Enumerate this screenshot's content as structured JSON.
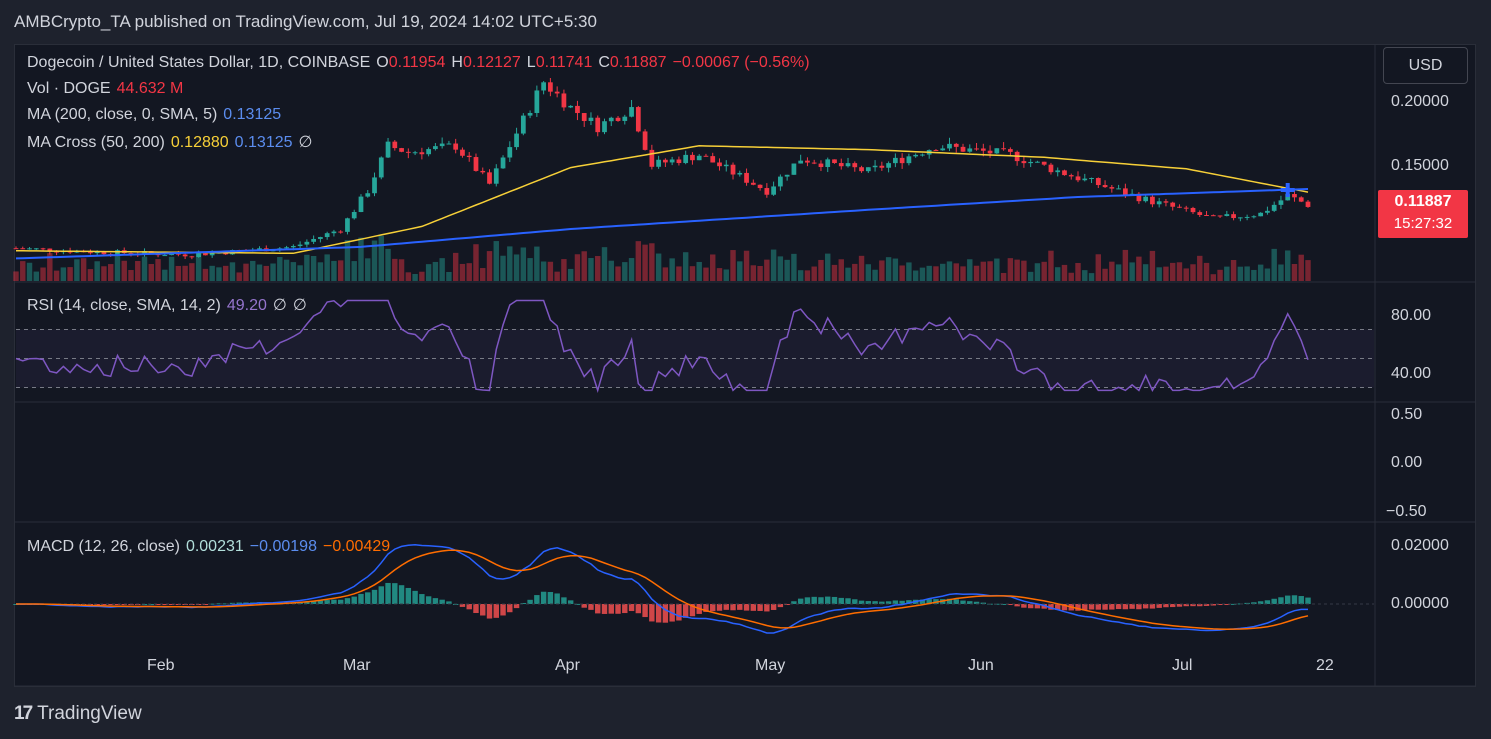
{
  "header": {
    "publisher_line": "AMBCrypto_TA published on TradingView.com, Jul 19, 2024 14:02 UTC+5:30"
  },
  "legend": {
    "symbol": "Dogecoin / United States Dollar, 1D, COINBASE",
    "o_label": "O",
    "o_value": "0.11954",
    "h_label": "H",
    "h_value": "0.12127",
    "l_label": "L",
    "l_value": "0.11741",
    "c_label": "C",
    "c_value": "0.11887",
    "change": "−0.00067 (−0.56%)",
    "vol_label": "Vol · DOGE",
    "vol_value": "44.632 M",
    "ma_label": "MA (200, close, 0, SMA, 5)",
    "ma_value": "0.13125",
    "cross_label": "MA Cross (50, 200)",
    "cross_v1": "0.12880",
    "cross_v2": "0.13125",
    "cross_v3": "∅",
    "rsi_label": "RSI (14, close, SMA, 14, 2)",
    "rsi_value": "49.20",
    "rsi_v2": "∅",
    "rsi_v3": "∅",
    "macd_label": "MACD (12, 26, close)",
    "macd_v1": "0.00231",
    "macd_v2": "−0.00198",
    "macd_v3": "−0.00429"
  },
  "currency_button": "USD",
  "price_tag": {
    "price": "0.11887",
    "countdown": "15:27:32"
  },
  "price_axis": [
    "0.20000",
    "0.15000"
  ],
  "rsi_axis": [
    "80.00",
    "40.00"
  ],
  "mid_axis": [
    "0.50",
    "0.00",
    "−0.50"
  ],
  "macd_axis": [
    "0.02000",
    "0.00000"
  ],
  "time_axis": [
    "Feb",
    "Mar",
    "Apr",
    "May",
    "Jun",
    "Jul",
    "22"
  ],
  "footer": {
    "brand": "TradingView",
    "logo": "17"
  },
  "colors": {
    "up": "#26a69a",
    "down": "#f23645",
    "ma50": "#f7d038",
    "ma200": "#2962ff",
    "rsi": "#7e57c2",
    "macd_line": "#2962ff",
    "signal": "#ff6d00"
  },
  "chart_data": {
    "type": "candlestick",
    "symbol": "DOGE/USD",
    "interval": "1D",
    "x_range": [
      "2024-01-10",
      "2024-07-19"
    ],
    "y_range": [
      0.09,
      0.225
    ],
    "close_path": [
      [
        "2024-01-10",
        0.085
      ],
      [
        "2024-01-22",
        0.082
      ],
      [
        "2024-02-05",
        0.08
      ],
      [
        "2024-02-20",
        0.086
      ],
      [
        "2024-02-27",
        0.1
      ],
      [
        "2024-03-02",
        0.13
      ],
      [
        "2024-03-05",
        0.165
      ],
      [
        "2024-03-08",
        0.16
      ],
      [
        "2024-03-15",
        0.165
      ],
      [
        "2024-03-20",
        0.135
      ],
      [
        "2024-03-24",
        0.175
      ],
      [
        "2024-03-28",
        0.215
      ],
      [
        "2024-04-01",
        0.195
      ],
      [
        "2024-04-05",
        0.18
      ],
      [
        "2024-04-10",
        0.195
      ],
      [
        "2024-04-13",
        0.15
      ],
      [
        "2024-04-20",
        0.158
      ],
      [
        "2024-04-30",
        0.13
      ],
      [
        "2024-05-05",
        0.155
      ],
      [
        "2024-05-15",
        0.145
      ],
      [
        "2024-05-25",
        0.165
      ],
      [
        "2024-06-05",
        0.158
      ],
      [
        "2024-06-15",
        0.14
      ],
      [
        "2024-06-25",
        0.123
      ],
      [
        "2024-07-05",
        0.108
      ],
      [
        "2024-07-12",
        0.112
      ],
      [
        "2024-07-16",
        0.126
      ],
      [
        "2024-07-19",
        0.11887
      ]
    ],
    "ma50_path": [
      [
        "2024-01-10",
        0.083
      ],
      [
        "2024-02-20",
        0.081
      ],
      [
        "2024-03-10",
        0.102
      ],
      [
        "2024-04-01",
        0.148
      ],
      [
        "2024-04-20",
        0.165
      ],
      [
        "2024-05-15",
        0.162
      ],
      [
        "2024-06-10",
        0.156
      ],
      [
        "2024-07-01",
        0.147
      ],
      [
        "2024-07-19",
        0.1288
      ]
    ],
    "ma200_path": [
      [
        "2024-01-10",
        0.077
      ],
      [
        "2024-03-01",
        0.086
      ],
      [
        "2024-04-01",
        0.1
      ],
      [
        "2024-05-15",
        0.115
      ],
      [
        "2024-06-15",
        0.125
      ],
      [
        "2024-07-19",
        0.13125
      ]
    ],
    "rsi": {
      "levels": [
        70,
        50,
        30
      ],
      "last": 49.2
    },
    "macd": {
      "macd": -0.00198,
      "signal": -0.00429,
      "histogram": 0.00231
    }
  }
}
